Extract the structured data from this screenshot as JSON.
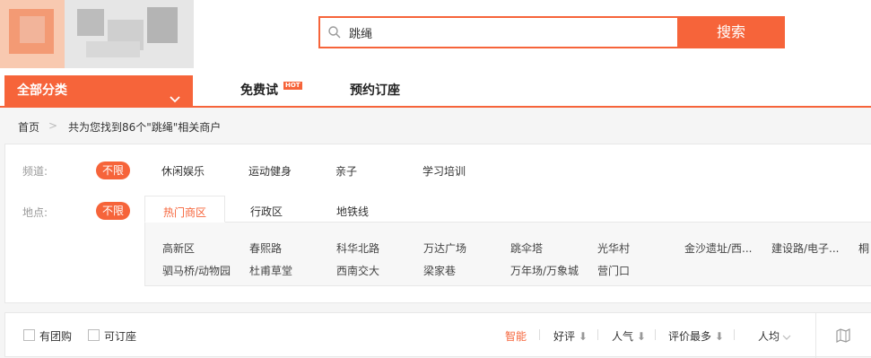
{
  "search": {
    "query": "跳绳",
    "button_label": "搜索"
  },
  "nav": {
    "all_categories": "全部分类",
    "free_trial": "免费试",
    "hot_badge": "HOT",
    "reserve": "预约订座"
  },
  "breadcrumb": {
    "home": "首页",
    "separator": ">",
    "result_text": "共为您找到86个\"跳绳\"相关商户"
  },
  "filter": {
    "channel_label": "频道:",
    "channel_selected": "不限",
    "channels": [
      "休闲娱乐",
      "运动健身",
      "亲子",
      "学习培训"
    ],
    "location_label": "地点:",
    "location_selected": "不限",
    "location_tabs": [
      "热门商区",
      "行政区",
      "地铁线"
    ],
    "areas_row1": [
      "高新区",
      "春熙路",
      "科华北路",
      "万达广场",
      "跳伞塔",
      "光华村",
      "金沙遗址/西...",
      "建设路/电子...",
      "桐"
    ],
    "areas_row2": [
      "驷马桥/动物园",
      "杜甫草堂",
      "西南交大",
      "梁家巷",
      "万年场/万象城",
      "营门口"
    ]
  },
  "sortbar": {
    "group_buy": "有团购",
    "reservable": "可订座",
    "smart": "智能",
    "rating": "好评",
    "popularity": "人气",
    "most_reviews": "评价最多",
    "per_capita": "人均"
  },
  "colors": {
    "accent": "#f6643a"
  }
}
